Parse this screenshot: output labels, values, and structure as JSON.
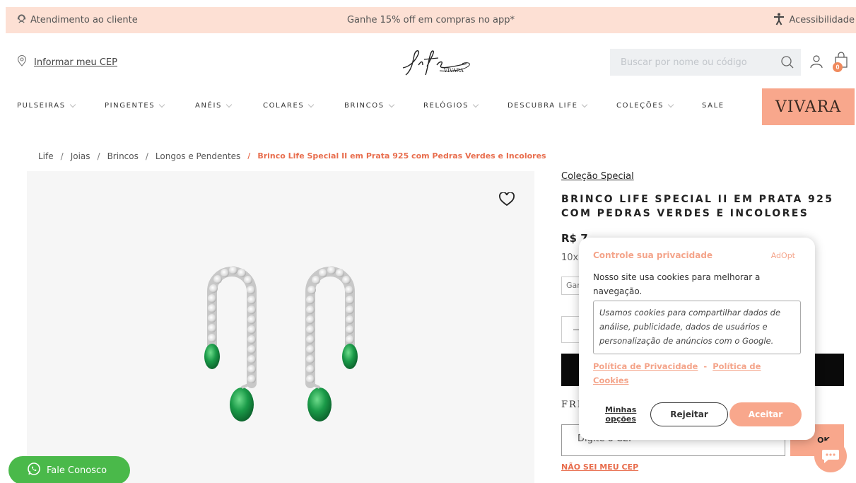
{
  "topbar": {
    "support_label": "Atendimento ao cliente",
    "promo": "Ganhe 15% off em compras no app*",
    "accessibility_label": "Acessibilidade"
  },
  "header": {
    "cep_label": "Informar meu CEP",
    "logo_text": "Life",
    "logo_sub": "VIVARA",
    "search_placeholder": "Buscar por nome ou código",
    "cart_count": "0"
  },
  "nav": {
    "items": [
      {
        "label": "PULSEIRAS",
        "has_dropdown": true
      },
      {
        "label": "PINGENTES",
        "has_dropdown": true
      },
      {
        "label": "ANÉIS",
        "has_dropdown": true
      },
      {
        "label": "COLARES",
        "has_dropdown": true
      },
      {
        "label": "BRINCOS",
        "has_dropdown": true
      },
      {
        "label": "RELÓGIOS",
        "has_dropdown": true
      },
      {
        "label": "DESCUBRA LIFE",
        "has_dropdown": true
      },
      {
        "label": "COLEÇÕES",
        "has_dropdown": true
      },
      {
        "label": "SALE",
        "has_dropdown": false
      }
    ],
    "vivara_label": "VIVARA"
  },
  "breadcrumb": {
    "items": [
      "Life",
      "Joias",
      "Brincos",
      "Longos e Pendentes"
    ],
    "current": "Brinco Life Special II em Prata 925 com Pedras Verdes e Incolores",
    "separator": "/"
  },
  "product": {
    "collection": "Coleção Special",
    "title": "BRINCO LIFE SPECIAL II EM PRATA 925 COM PEDRAS VERDES E INCOLORES",
    "price_visible": "R$ 7",
    "installments_visible": "10x",
    "guarantee_visible": "Gar",
    "frete_visible": "FRE",
    "cep_placeholder": "Digite o CEP",
    "ok_label": "OK",
    "no_cep_label": "NÃO SEI MEU CEP"
  },
  "chat": {
    "fale_label": "Fale Conosco"
  },
  "privacy_modal": {
    "title": "Controle sua privacidade",
    "brand": "AdOpt",
    "text": "Nosso site usa cookies para melhorar a navegação.",
    "box_text": "Usamos cookies para compartilhar dados de análise, publicidade, dados de usuários e personalização de anúncios com o Google.",
    "link_privacy": "Política de Privacidade",
    "link_separator": "-",
    "link_cookies": "Política de Cookies",
    "options_label_1": "Minhas",
    "options_label_2": "opções",
    "reject_label": "Rejeitar",
    "accept_label": "Aceitar"
  },
  "colors": {
    "topbar_bg": "#fde0d4",
    "accent": "#f8a78c",
    "accent_text": "#e86d4d",
    "whatsapp": "#4ab94a",
    "buy_button": "#0a0a0a"
  },
  "icons": {
    "support": "support-agent-icon",
    "accessibility": "accessibility-icon",
    "location": "location-pin-icon",
    "search": "search-icon",
    "user": "user-icon",
    "cart": "shopping-bag-icon",
    "favorite": "heart-icon",
    "whatsapp": "whatsapp-icon",
    "chat": "chat-icon"
  }
}
